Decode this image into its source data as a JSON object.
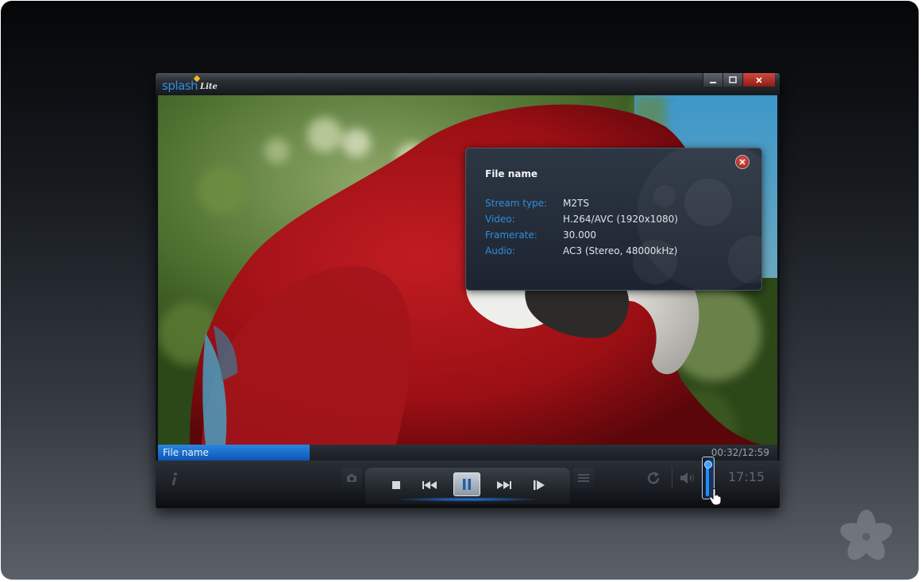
{
  "app": {
    "logo_main": "splash",
    "logo_sub": "Lite"
  },
  "window_controls": [
    "minimize-icon",
    "maximize-icon",
    "close-icon"
  ],
  "info_panel": {
    "title": "File name",
    "rows": [
      {
        "label": "Stream type:",
        "value": "M2TS"
      },
      {
        "label": "Video:",
        "value": "H.264/AVC (1920x1080)"
      },
      {
        "label": "Framerate:",
        "value": "30.000"
      },
      {
        "label": "Audio:",
        "value": "AC3 (Stereo, 48000kHz)"
      }
    ]
  },
  "status": {
    "file_name": "File name",
    "time": "00:32/12:59",
    "progress_fraction": 0.245
  },
  "controls": {
    "icons": [
      "info-icon",
      "snapshot-icon",
      "stop-icon",
      "previous-icon",
      "pause-icon",
      "next-icon",
      "step-forward-icon",
      "playlist-icon",
      "repeat-icon",
      "volume-icon"
    ],
    "clock": "17:15",
    "volume_fraction": 0.95
  },
  "colors": {
    "accent": "#2f8fe0",
    "close": "#c0392b"
  }
}
